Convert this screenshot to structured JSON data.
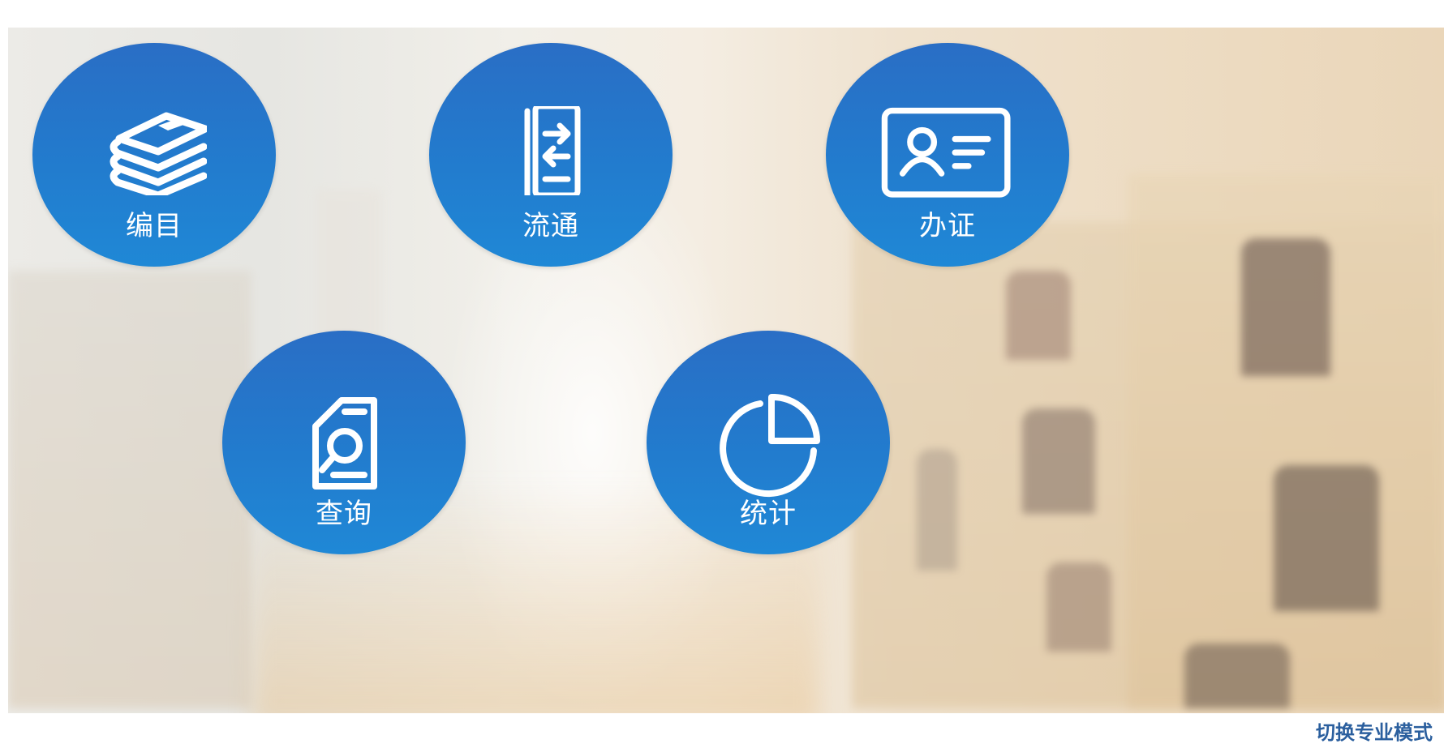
{
  "modules": [
    {
      "id": "cataloging",
      "label": "编目",
      "icon": "books-stack-icon"
    },
    {
      "id": "circulation",
      "label": "流通",
      "icon": "exchange-document-icon"
    },
    {
      "id": "card",
      "label": "办证",
      "icon": "id-card-icon"
    },
    {
      "id": "search",
      "label": "查询",
      "icon": "document-search-icon"
    },
    {
      "id": "statistics",
      "label": "统计",
      "icon": "pie-chart-icon"
    }
  ],
  "footer": {
    "switch_mode_label": "切换专业模式"
  },
  "colors": {
    "hub_top": "#2a6ec5",
    "hub_bottom": "#1f88d6",
    "switch_link": "#2b5f9e"
  }
}
